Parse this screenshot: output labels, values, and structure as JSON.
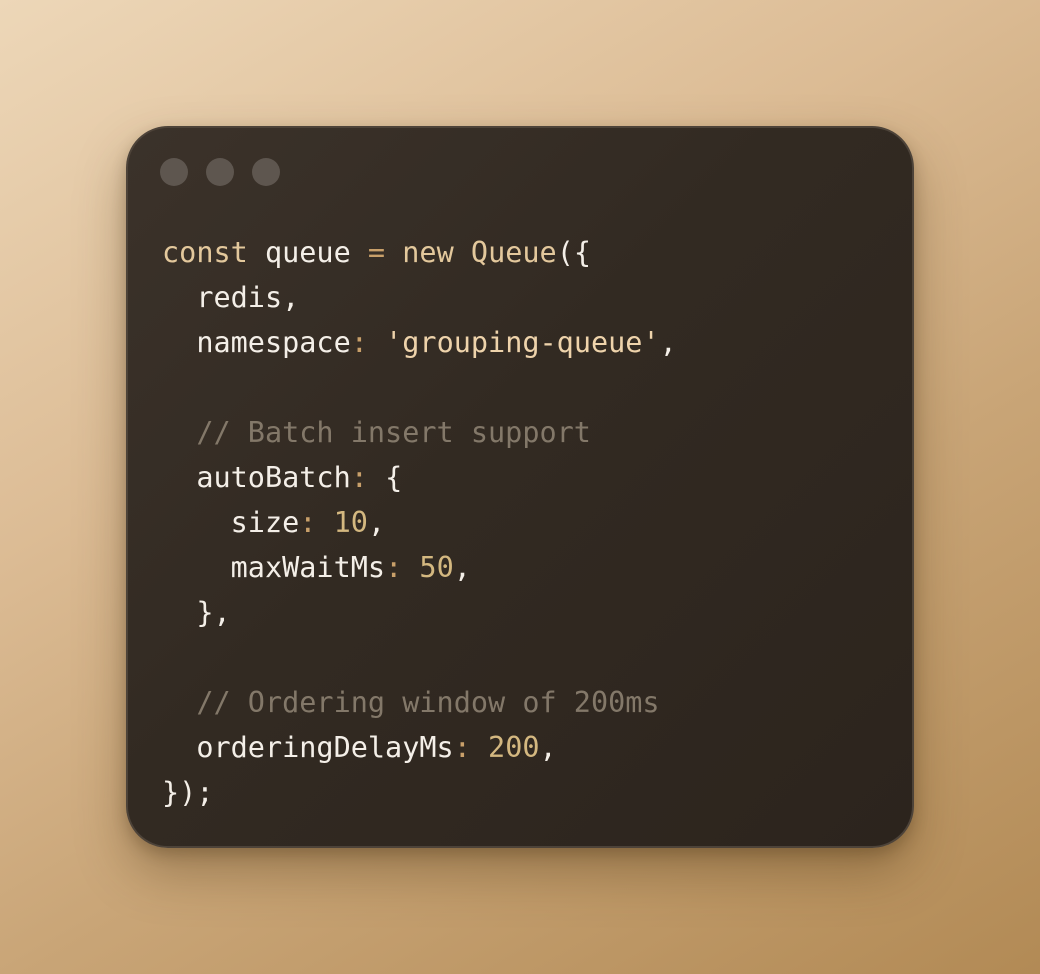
{
  "window": {
    "controls": [
      "close",
      "minimize",
      "maximize"
    ]
  },
  "code": {
    "lines": [
      [
        {
          "t": "const",
          "c": "kw"
        },
        {
          "t": " queue ",
          "c": "pl"
        },
        {
          "t": "=",
          "c": "op"
        },
        {
          "t": " ",
          "c": "pl"
        },
        {
          "t": "new",
          "c": "kw"
        },
        {
          "t": " ",
          "c": "pl"
        },
        {
          "t": "Queue",
          "c": "ty"
        },
        {
          "t": "({",
          "c": "pl"
        }
      ],
      [
        {
          "t": "  redis,",
          "c": "pl"
        }
      ],
      [
        {
          "t": "  namespace",
          "c": "pl"
        },
        {
          "t": ":",
          "c": "op"
        },
        {
          "t": " ",
          "c": "pl"
        },
        {
          "t": "'grouping-queue'",
          "c": "str"
        },
        {
          "t": ",",
          "c": "pl"
        }
      ],
      [],
      [
        {
          "t": "  // Batch insert support",
          "c": "com"
        }
      ],
      [
        {
          "t": "  autoBatch",
          "c": "pl"
        },
        {
          "t": ":",
          "c": "op"
        },
        {
          "t": " {",
          "c": "pl"
        }
      ],
      [
        {
          "t": "    size",
          "c": "pl"
        },
        {
          "t": ":",
          "c": "op"
        },
        {
          "t": " ",
          "c": "pl"
        },
        {
          "t": "10",
          "c": "num"
        },
        {
          "t": ",",
          "c": "pl"
        }
      ],
      [
        {
          "t": "    maxWaitMs",
          "c": "pl"
        },
        {
          "t": ":",
          "c": "op"
        },
        {
          "t": " ",
          "c": "pl"
        },
        {
          "t": "50",
          "c": "num"
        },
        {
          "t": ",",
          "c": "pl"
        }
      ],
      [
        {
          "t": "  },",
          "c": "pl"
        }
      ],
      [],
      [
        {
          "t": "  // Ordering window of 200ms",
          "c": "com"
        }
      ],
      [
        {
          "t": "  orderingDelayMs",
          "c": "pl"
        },
        {
          "t": ":",
          "c": "op"
        },
        {
          "t": " ",
          "c": "pl"
        },
        {
          "t": "200",
          "c": "num"
        },
        {
          "t": ",",
          "c": "pl"
        }
      ],
      [
        {
          "t": "});",
          "c": "pl"
        }
      ]
    ]
  },
  "colors": {
    "window_bg": "#342b23",
    "keyword": "#e3c89c",
    "string": "#eed3ab",
    "number": "#d4b880",
    "comment": "#837869",
    "text": "#f4efe8",
    "dot": "#5e564f"
  }
}
